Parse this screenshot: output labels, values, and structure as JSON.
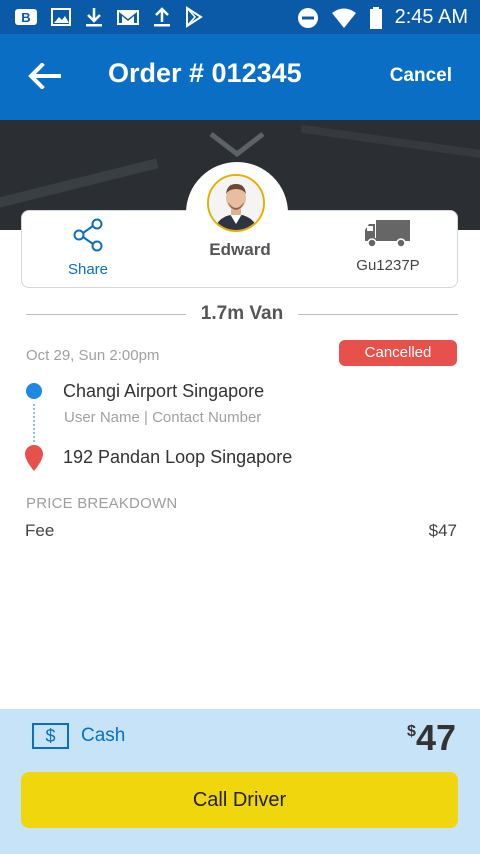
{
  "status_bar": {
    "time": "2:45 AM",
    "left_icons": [
      "b-app-icon",
      "image-icon",
      "download-icon",
      "gmail-icon",
      "upload-icon",
      "play-store-icon"
    ],
    "right_icons": [
      "do-not-disturb-icon",
      "wifi-icon",
      "battery-icon"
    ]
  },
  "header": {
    "title": "Order # 012345",
    "cancel_label": "Cancel",
    "color": "#0a6fc4"
  },
  "driver": {
    "name": "Edward",
    "share_label": "Share",
    "plate": "Gu1237P"
  },
  "vehicle_type": "1.7m Van",
  "order": {
    "datetime": "Oct 29, Sun 2:00pm",
    "status": "Cancelled",
    "status_color": "#e8504b"
  },
  "route": {
    "pickup": "Changi Airport Singapore",
    "pickup_contact": "User Name | Contact Number",
    "dropoff": "192 Pandan Loop Singapore"
  },
  "price_breakdown": {
    "title": "PRICE BREAKDOWN",
    "items": [
      {
        "label": "Fee",
        "value": "$47"
      }
    ]
  },
  "payment": {
    "method_icon": "$",
    "method_label": "Cash",
    "currency": "$",
    "total": "47"
  },
  "actions": {
    "call_driver_label": "Call Driver",
    "button_color": "#f0d60d"
  }
}
